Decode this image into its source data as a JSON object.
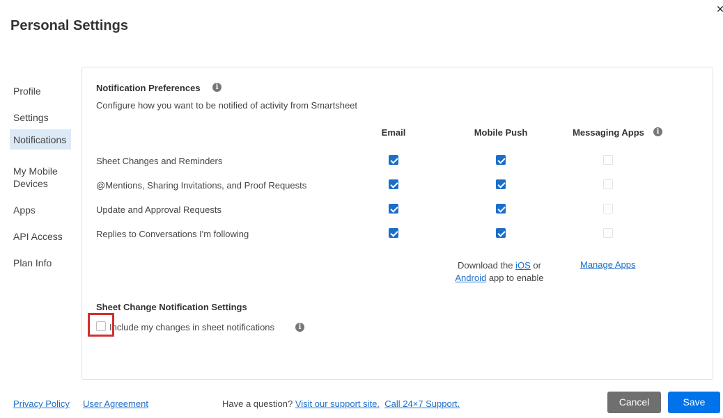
{
  "dialog": {
    "title": "Personal Settings",
    "close_symbol": "✕"
  },
  "sidebar": {
    "items": [
      {
        "label": "Profile"
      },
      {
        "label": "Settings"
      },
      {
        "label": "Notifications",
        "active": true
      },
      {
        "label": "My Mobile Devices"
      },
      {
        "label": "Apps"
      },
      {
        "label": "API Access"
      },
      {
        "label": "Plan Info"
      }
    ]
  },
  "notifications": {
    "title": "Notification Preferences",
    "info_icon": "info-icon",
    "subtitle": "Configure how you want to be notified of activity from Smartsheet",
    "columns": [
      "Email",
      "Mobile Push",
      "Messaging Apps"
    ],
    "rows": [
      {
        "label": "Sheet Changes and Reminders",
        "email": true,
        "push": true,
        "messaging": false
      },
      {
        "label": "@Mentions, Sharing Invitations, and Proof Requests",
        "email": true,
        "push": true,
        "messaging": false
      },
      {
        "label": "Update and Approval Requests",
        "email": true,
        "push": true,
        "messaging": false
      },
      {
        "label": "Replies to Conversations I'm following",
        "email": true,
        "push": true,
        "messaging": false
      }
    ],
    "download": {
      "prefix": "Download the",
      "ios": "iOS",
      "or": "or",
      "android": "Android",
      "suffix": "app to enable"
    },
    "manage_apps": "Manage Apps"
  },
  "sheet_change": {
    "title": "Sheet Change Notification Settings",
    "checkbox_label": "Include my changes in sheet notifications",
    "checked": false
  },
  "footer": {
    "privacy": "Privacy Policy",
    "agreement": "User Agreement",
    "question": "Have a question?",
    "support_site": "Visit our support site.",
    "call_support": "Call 24×7 Support.",
    "cancel": "Cancel",
    "save": "Save"
  },
  "colors": {
    "accent": "#0073ea",
    "checkbox": "#1a6fc9",
    "highlight": "#d32f2f",
    "active_nav": "#dce9f7",
    "cancel_bg": "#6f6f6f"
  }
}
